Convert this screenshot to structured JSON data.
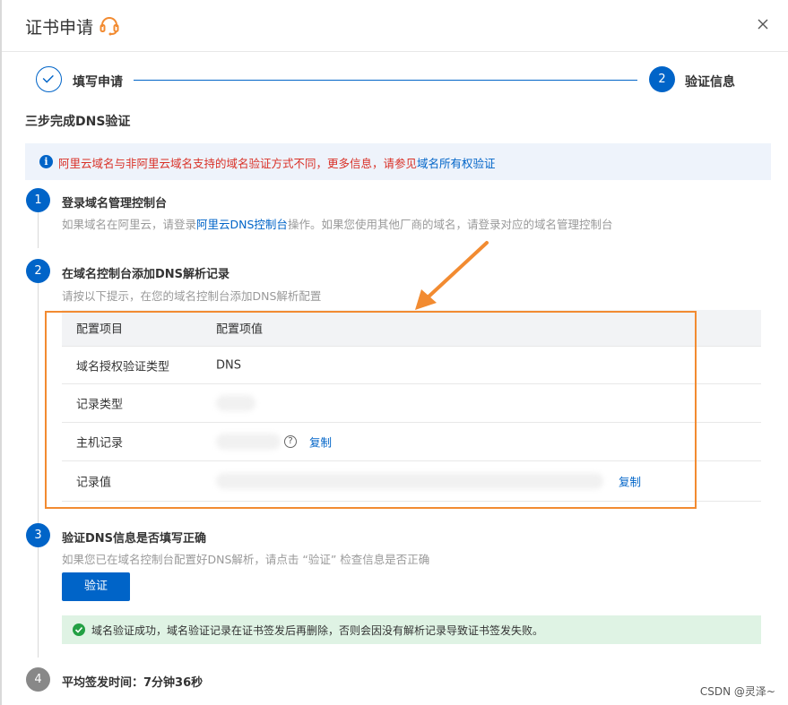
{
  "dialog": {
    "title": "证书申请",
    "headset_icon": "headset-icon",
    "close_icon": "close-icon"
  },
  "wizard": {
    "step1_label": "填写申请",
    "step2_number": "2",
    "step2_label": "验证信息"
  },
  "subtitle": "三步完成DNS验证",
  "notice": {
    "text": "阿里云域名与非阿里云域名支持的域名验证方式不同，更多信息，请参见",
    "link": "域名所有权验证"
  },
  "steps": [
    {
      "number": "1",
      "title": "登录域名管理控制台",
      "desc_pre": "如果域名在阿里云，请登录",
      "desc_link": "阿里云DNS控制台",
      "desc_post": "操作。如果您使用其他厂商的域名，请登录对应的域名管理控制台"
    },
    {
      "number": "2",
      "title": "在域名控制台添加DNS解析记录",
      "desc": "请按以下提示，在您的域名控制台添加DNS解析配置"
    },
    {
      "number": "3",
      "title": "验证DNS信息是否填写正确",
      "desc": "如果您已在域名控制台配置好DNS解析，请点击 “验证” 检查信息是否正确"
    },
    {
      "number": "4",
      "title": "平均签发时间：7分钟36秒"
    }
  ],
  "table": {
    "headers": [
      "配置项目",
      "配置项值"
    ],
    "rows": [
      {
        "label": "域名授权验证类型",
        "value": "DNS"
      },
      {
        "label": "记录类型",
        "value": ""
      },
      {
        "label": "主机记录",
        "value": "",
        "copy": "复制"
      },
      {
        "label": "记录值",
        "value": "",
        "copy": "复制"
      }
    ]
  },
  "verify_button": "验证",
  "success_message": "域名验证成功，域名验证记录在证书签发后再删除，否则会因没有解析记录导致证书签发失败。",
  "watermark": "CSDN @灵泽~",
  "colors": {
    "primary": "#0064c8",
    "error_text": "#d93026",
    "success_bg": "#dff3e4",
    "highlight": "#f28b31"
  }
}
